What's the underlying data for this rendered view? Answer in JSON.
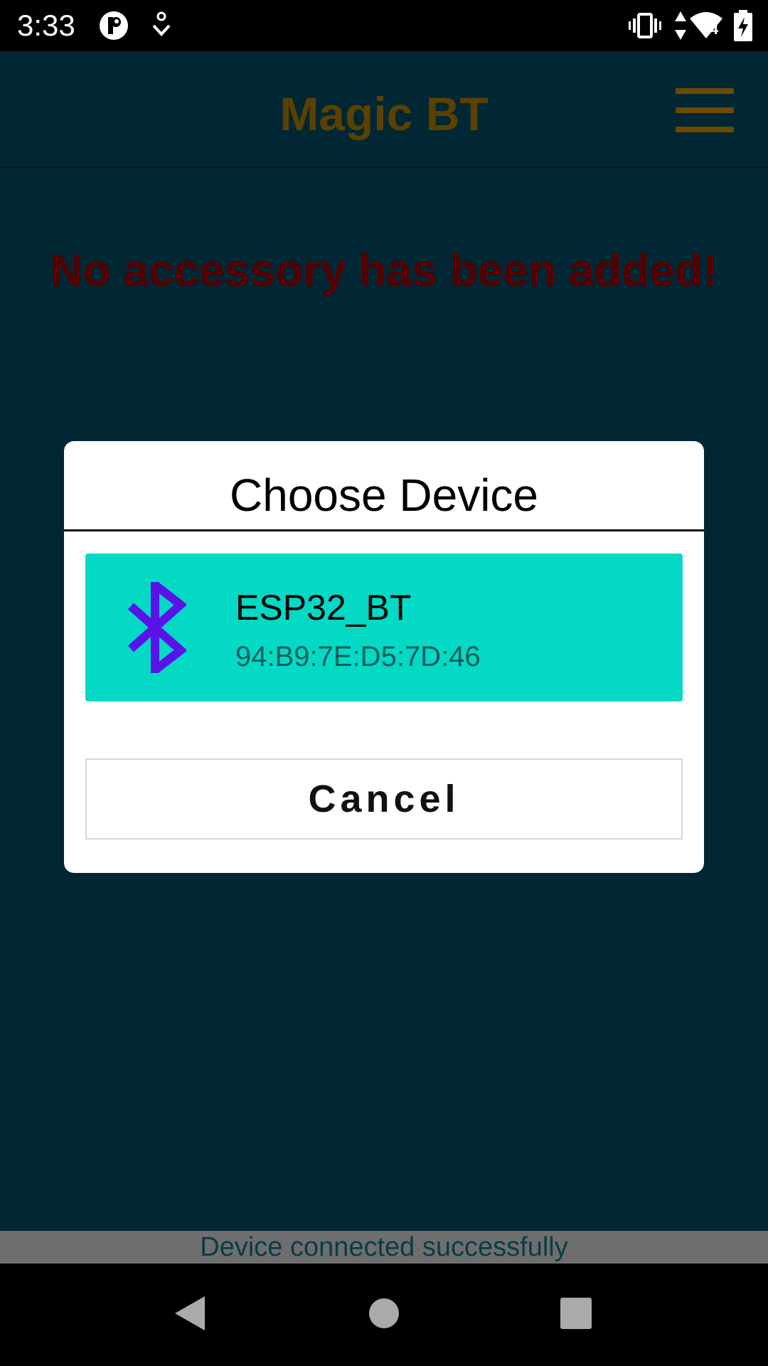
{
  "status_bar": {
    "time": "3:33",
    "network_type": "4",
    "icons": [
      "app-notification-icon",
      "download-icon",
      "vibrate-icon",
      "data-arrows-icon",
      "wifi-signal-icon",
      "battery-charging-icon"
    ]
  },
  "app_bar": {
    "title": "Magic BT",
    "menu_icon": "hamburger-menu-icon"
  },
  "main": {
    "empty_message": "No accessory has been added!"
  },
  "dialog": {
    "title": "Choose Device",
    "devices": [
      {
        "name": "ESP32_BT",
        "address": "94:B9:7E:D5:7D:46",
        "icon": "bluetooth-icon"
      }
    ],
    "cancel_label": "Cancel"
  },
  "toast": {
    "message": "Device connected successfully"
  },
  "nav_bar": {
    "buttons": [
      "back-icon",
      "home-icon",
      "recents-icon"
    ]
  },
  "colors": {
    "background": "#002733",
    "title": "#5a4100",
    "empty_message": "#550000",
    "device_highlight": "#03d9c5",
    "bluetooth_icon": "#5b12e8"
  }
}
